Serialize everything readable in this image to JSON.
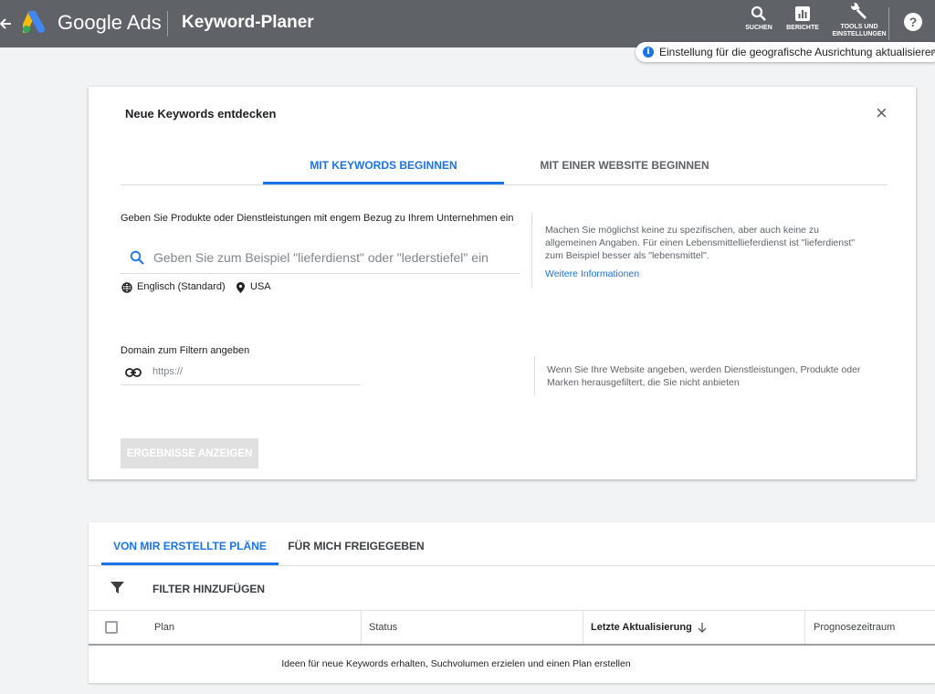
{
  "topbar": {
    "back_icon": "arrow-left-icon",
    "logo_icon": "google-ads-logo-icon",
    "brand": "Google Ads",
    "page_title": "Keyword-Planer",
    "tools": [
      {
        "icon": "search-icon",
        "label": "SUCHEN"
      },
      {
        "icon": "bar-chart-icon",
        "label": "BERICHTE"
      },
      {
        "icon": "wrench-icon",
        "label_line1": "TOOLS UND",
        "label_line2": "EINSTELLUNGEN"
      }
    ],
    "help_icon": "help-icon",
    "help_glyph": "?",
    "colors": {
      "bar": "#5f6368",
      "text": "#ffffff"
    }
  },
  "geo_notice": {
    "icon": "info-icon",
    "icon_glyph": "i",
    "text": "Einstellung für die geografische Ausrichtung aktualisieren",
    "close_glyph": "×"
  },
  "discover_card": {
    "title": "Neue Keywords entdecken",
    "close_glyph": "×",
    "tabs": [
      {
        "label": "MIT KEYWORDS BEGINNEN",
        "active": true
      },
      {
        "label": "MIT EINER WEBSITE BEGINNEN",
        "active": false
      }
    ],
    "keywords_label": "Geben Sie Produkte oder Dienstleistungen mit engem Bezug zu Ihrem Unternehmen ein",
    "keywords_placeholder": "Geben Sie zum Beispiel \"lieferdienst\" oder \"lederstiefel\" ein",
    "language": "Englisch (Standard)",
    "location": "USA",
    "keywords_hint": "Machen Sie möglichst keine zu spezifischen, aber auch keine zu allgemeinen Angaben. Für einen Lebensmittellieferdienst ist \"lieferdienst\" zum Beispiel besser als \"lebensmittel\".",
    "more_info_link": "Weitere Informationen",
    "domain_label": "Domain zum Filtern angeben",
    "domain_placeholder": "https://",
    "domain_hint": "Wenn Sie Ihre Website angeben, werden Dienstleistungen, Produkte oder Marken herausgefiltert, die Sie nicht anbieten",
    "results_button": "ERGEBNISSE ANZEIGEN",
    "colors": {
      "accent": "#1a73e8",
      "button_disabled": "#e0e0e0"
    }
  },
  "plans": {
    "tabs": [
      {
        "label": "VON MIR ERSTELLTE PLÄNE",
        "active": true
      },
      {
        "label": "FÜR MICH FREIGEGEBEN",
        "active": false
      }
    ],
    "filter_label": "FILTER HINZUFÜGEN",
    "columns": [
      "Plan",
      "Status",
      "Letzte Aktualisierung",
      "Prognosezeitraum"
    ],
    "sorted_column": "Letzte Aktualisierung",
    "sort_direction": "descending",
    "empty_message": "Ideen für neue Keywords erhalten, Suchvolumen erzielen und einen Plan erstellen"
  }
}
